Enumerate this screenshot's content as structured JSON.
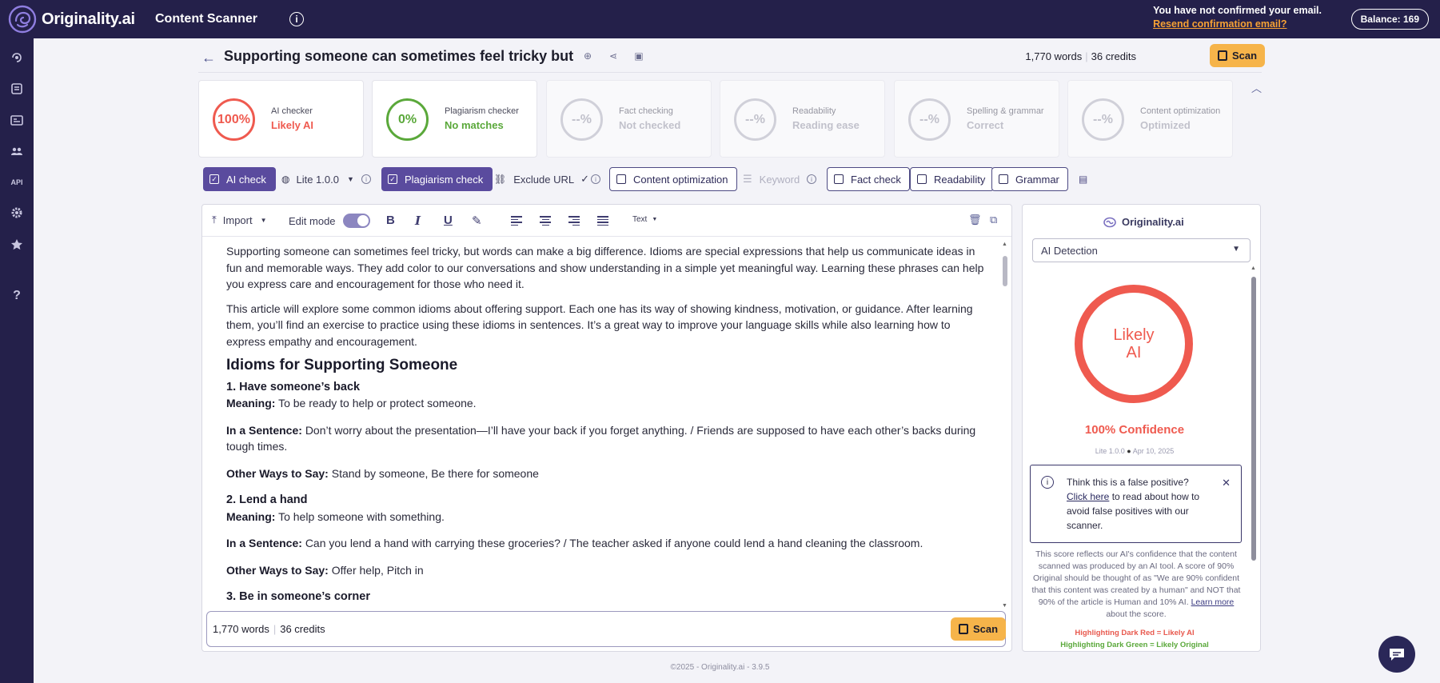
{
  "topbar": {
    "brand": "Originality.ai",
    "product": "Content Scanner",
    "email_notice": "You have not confirmed your email.",
    "resend_link": "Resend confirmation email?",
    "balance": "Balance: 169"
  },
  "doc": {
    "title": "Supporting someone can sometimes feel tricky but",
    "words": "1,770 words",
    "credits": "36 credits",
    "scan_label": "Scan"
  },
  "cards": [
    {
      "pct": "100%",
      "label": "AI checker",
      "value": "Likely AI",
      "color": "#ef5a4f"
    },
    {
      "pct": "0%",
      "label": "Plagiarism checker",
      "value": "No matches",
      "color": "#5aa83a"
    },
    {
      "pct": "--%",
      "label": "Fact checking",
      "value": "Not checked",
      "color": "#b5b5c0"
    },
    {
      "pct": "--%",
      "label": "Readability",
      "value": "Reading ease",
      "color": "#b5b5c0"
    },
    {
      "pct": "--%",
      "label": "Spelling & grammar",
      "value": "Correct",
      "color": "#b5b5c0"
    },
    {
      "pct": "--%",
      "label": "Content optimization",
      "value": "Optimized",
      "color": "#b5b5c0"
    }
  ],
  "toolbar": {
    "ai_check": "AI check",
    "lite_version": "Lite 1.0.0",
    "plagiarism_check": "Plagiarism check",
    "exclude_url": "Exclude URL",
    "content_optimization": "Content optimization",
    "keyword": "Keyword",
    "fact_check": "Fact check",
    "readability": "Readability",
    "grammar": "Grammar"
  },
  "editor": {
    "import": "Import",
    "edit_mode": "Edit mode",
    "text_style": "Text",
    "p1": "Supporting someone can sometimes feel tricky, but words can make a big difference. Idioms are special expressions that help us communicate ideas in fun and memorable ways. They add color to our conversations and show understanding in a simple yet meaningful way. Learning these phrases can help you express care and encouragement for those who need it.",
    "p2": "This article will explore some common idioms about offering support. Each one has its way of showing kindness, motivation, or guidance. After learning them, you’ll find an exercise to practice using these idioms in sentences. It’s a great way to improve your language skills while also learning how to express empathy and encouragement.",
    "h2": "Idioms for Supporting Someone",
    "items": [
      {
        "heading": "1. Have someone’s back",
        "meaning_label": "Meaning:",
        "meaning": "To be ready to help or protect someone.",
        "sentence_label": "In a Sentence:",
        "sentence": "Don’t worry about the presentation—I’ll have your back if you forget anything. / Friends are supposed to have each other’s backs during tough times.",
        "other_label": "Other Ways to Say:",
        "other": "Stand by someone, Be there for someone"
      },
      {
        "heading": "2. Lend a hand",
        "meaning_label": "Meaning:",
        "meaning": "To help someone with something.",
        "sentence_label": "In a Sentence:",
        "sentence": "Can you lend a hand with carrying these groceries? / The teacher asked if anyone could lend a hand cleaning the classroom.",
        "other_label": "Other Ways to Say:",
        "other": "Offer help, Pitch in"
      }
    ],
    "h3_partial": "3. Be in someone’s corner",
    "footer_words": "1,770 words",
    "footer_credits": "36 credits",
    "footer_scan": "Scan"
  },
  "right_panel": {
    "brand": "Originality.ai",
    "select": "AI Detection",
    "ring_line1": "Likely",
    "ring_line2": "AI",
    "confidence": "100% Confidence",
    "version": "Lite 1.0.0",
    "date": "Apr 10, 2025",
    "fp_question": "Think this is a false positive?",
    "fp_link": "Click here",
    "fp_rest": " to read about how to avoid false positives with our scanner.",
    "explain": "This score reflects our AI's confidence that the content scanned was produced by an AI tool. A score of 90% Original should be thought of as \"We are 90% confident that this content was created by a human\" and NOT that 90% of the article is Human and 10% AI.",
    "learn_more": "Learn more",
    "explain_tail": " about the score.",
    "hl_red": "Highlighting Dark Red = Likely AI",
    "hl_green": "Highlighting Dark Green = Likely Original"
  },
  "footer": {
    "copyright": "©2025 - Originality.ai - 3.9.5"
  },
  "colors": {
    "nav": "#24204a",
    "accent": "#5a4b9e",
    "scan": "#f6b44a",
    "ai_red": "#ef5a4f",
    "plag_green": "#5aa83a"
  }
}
